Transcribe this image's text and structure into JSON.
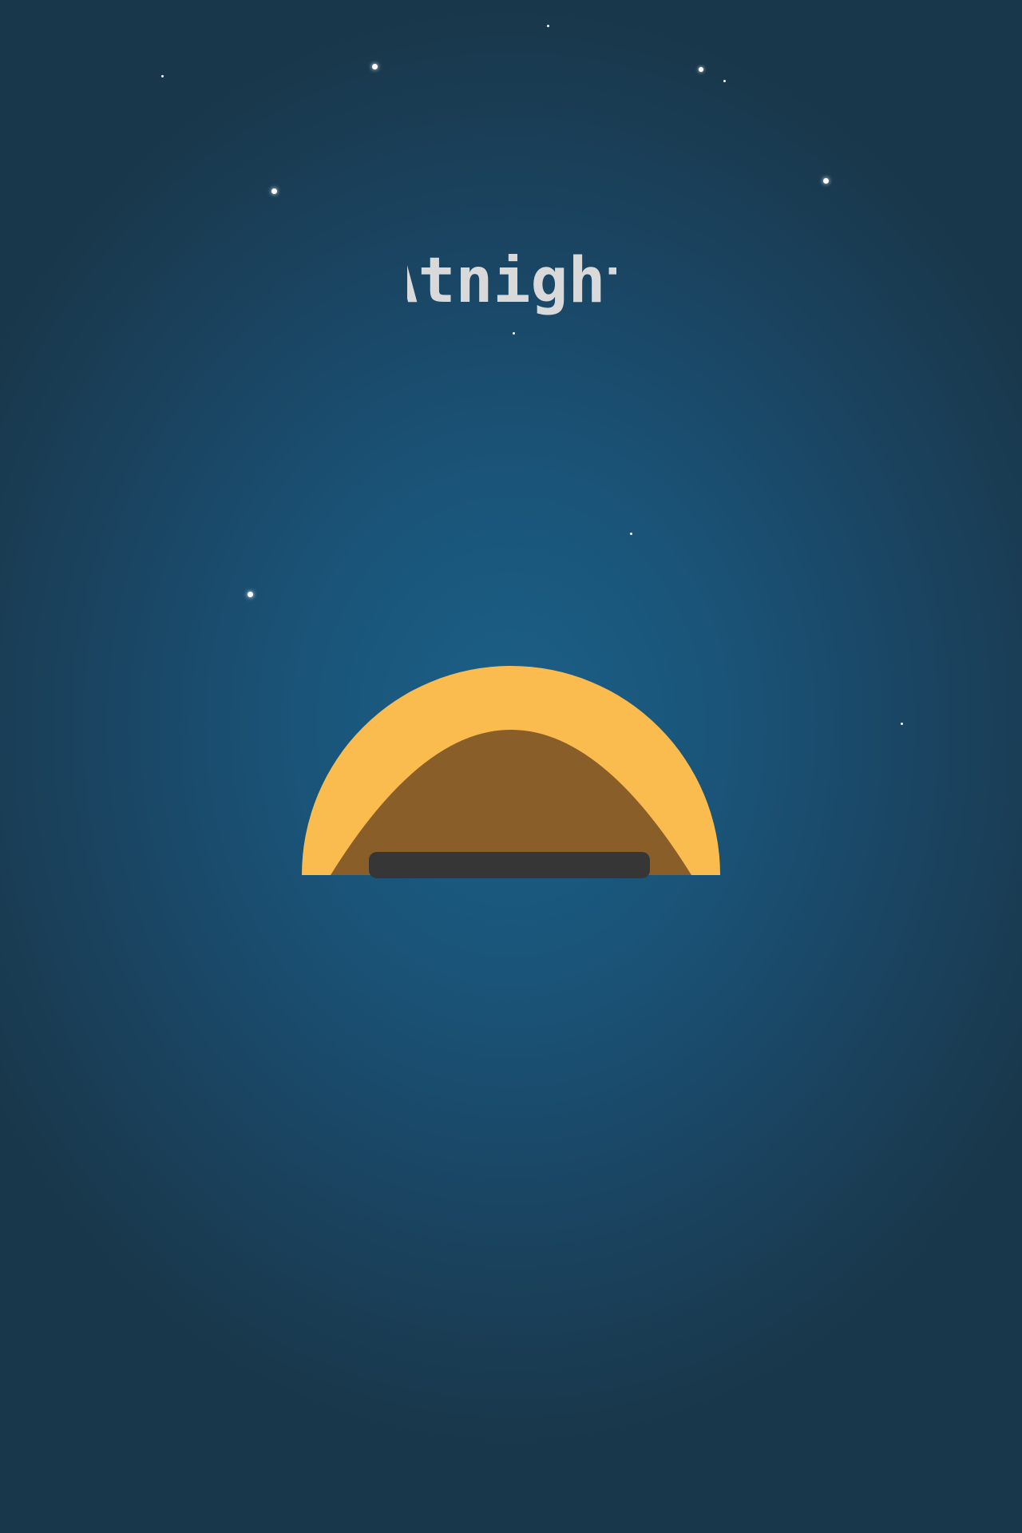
{
  "app": {
    "title": "Atnight"
  },
  "icons": {
    "logo": "sunrise-hat-icon",
    "stars": "star-icon"
  },
  "colors": {
    "background_center": "#1c6088",
    "background_edge": "#19374a",
    "title_text": "#d9d9d9",
    "sun": "#fabb4f",
    "inner_arc": "#8a5e28",
    "bar": "#363636",
    "star": "#ffffff"
  }
}
